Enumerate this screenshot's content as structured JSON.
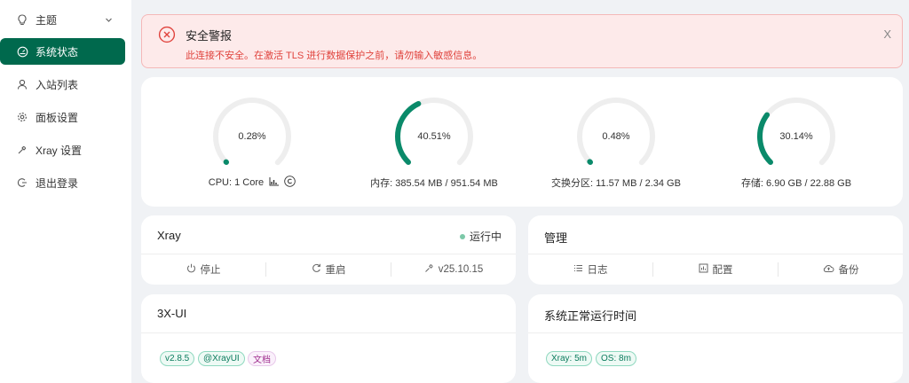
{
  "sidebar": {
    "items": [
      {
        "label": "主题",
        "icon": "bulb-icon"
      },
      {
        "label": "系统状态",
        "icon": "dashboard-icon"
      },
      {
        "label": "入站列表",
        "icon": "user-icon"
      },
      {
        "label": "面板设置",
        "icon": "gear-icon"
      },
      {
        "label": "Xray 设置",
        "icon": "wrench-icon"
      },
      {
        "label": "退出登录",
        "icon": "logout-icon"
      }
    ]
  },
  "alert": {
    "title": "安全警报",
    "message": "此连接不安全。在激活 TLS 进行数据保护之前，请勿输入敏感信息。",
    "close": "X"
  },
  "gauges": [
    {
      "percent": 0.28,
      "text": "0.28%",
      "label": "CPU: 1 Core"
    },
    {
      "percent": 40.51,
      "text": "40.51%",
      "label": "内存: 385.54 MB / 951.54 MB"
    },
    {
      "percent": 0.48,
      "text": "0.48%",
      "label": "交换分区: 11.57 MB / 2.34 GB"
    },
    {
      "percent": 30.14,
      "text": "30.14%",
      "label": "存储: 6.90 GB / 22.88 GB"
    }
  ],
  "xray": {
    "title": "Xray",
    "status": "运行中",
    "actions": {
      "stop": "停止",
      "restart": "重启",
      "version": "v25.10.15"
    }
  },
  "manage": {
    "title": "管理",
    "actions": {
      "logs": "日志",
      "config": "配置",
      "backup": "备份"
    }
  },
  "app": {
    "title": "3X-UI",
    "tags": [
      "v2.8.5",
      "@XrayUI",
      "文档"
    ]
  },
  "uptime": {
    "title": "系统正常运行时间",
    "tags": [
      "Xray: 5m",
      "OS: 8m"
    ]
  },
  "colors": {
    "accent": "#00694d",
    "gauge_track": "#eeeeee",
    "gauge_fill": "#0a8a6a",
    "alert_red": "#e0433d"
  }
}
